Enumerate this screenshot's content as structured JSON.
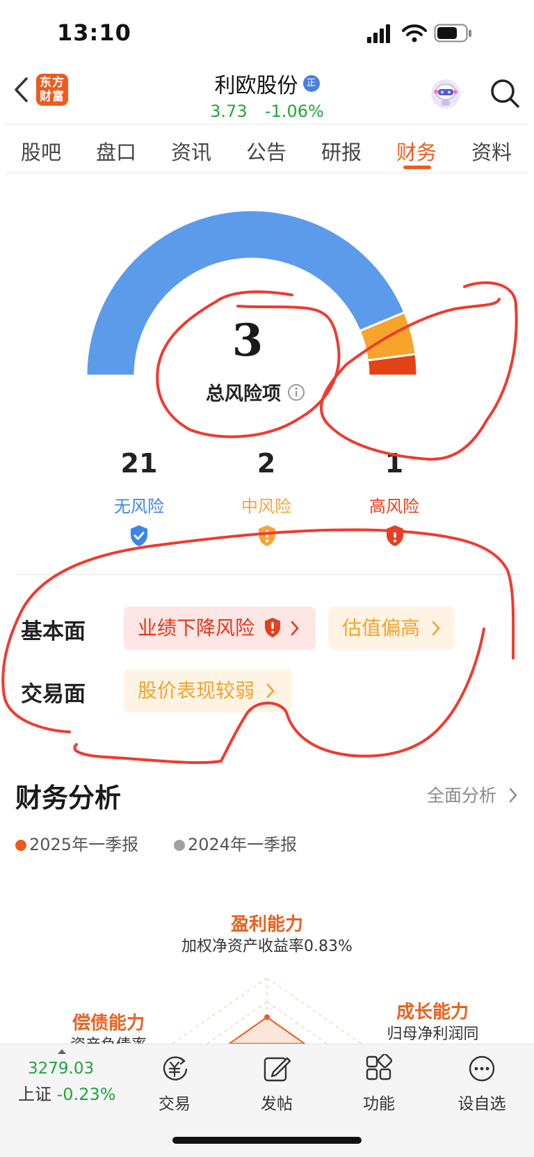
{
  "status_bar": {
    "time": "13:10"
  },
  "header": {
    "logo_text": "东方财富",
    "stock_name": "利欧股份",
    "name_badge": "正",
    "price": "3.73",
    "change": "-1.06%"
  },
  "tabs": [
    {
      "label": "股吧"
    },
    {
      "label": "盘口"
    },
    {
      "label": "资讯"
    },
    {
      "label": "公告"
    },
    {
      "label": "研报"
    },
    {
      "label": "财务",
      "active": true
    },
    {
      "label": "资料"
    }
  ],
  "risk_gauge": {
    "total_count": "3",
    "total_label": "总风险项",
    "segments": {
      "no_risk": 21,
      "medium_risk": 2,
      "high_risk": 1
    },
    "colors": {
      "no_risk": "#5b9bea",
      "medium_risk": "#f6a42b",
      "high_risk": "#e44318"
    },
    "items": [
      {
        "count": "21",
        "label": "无风险",
        "color": "#3f83e6"
      },
      {
        "count": "2",
        "label": "中风险",
        "color": "#f5a43b"
      },
      {
        "count": "1",
        "label": "高风险",
        "color": "#e2401f"
      }
    ]
  },
  "risk_rows": {
    "fundamental_label": "基本面",
    "fundamental_chips": [
      {
        "label": "业绩下降风险",
        "level": "high"
      },
      {
        "label": "估值偏高",
        "level": "medium"
      }
    ],
    "trading_label": "交易面",
    "trading_chips": [
      {
        "label": "股价表现较弱",
        "level": "medium"
      }
    ]
  },
  "finance": {
    "title": "财务分析",
    "more_link": "全面分析",
    "legend": [
      {
        "label": "2025年一季报",
        "color": "#ee5a1d"
      },
      {
        "label": "2024年一季报",
        "color": "#a0a0a0"
      }
    ],
    "radar": {
      "top_title": "盈利能力",
      "top_sub": "加权净资产收益率0.83%",
      "left_title": "偿债能力",
      "left_sub": "资产负债率",
      "right_title": "成长能力",
      "right_sub": "归母净利润同"
    }
  },
  "bottom_bar": {
    "index_value": "3279.03",
    "index_name": "上证",
    "index_change": "-0.23%",
    "items": [
      {
        "label": "交易",
        "icon": "yuan-exchange-icon"
      },
      {
        "label": "发帖",
        "icon": "edit-icon"
      },
      {
        "label": "功能",
        "icon": "grid-icon"
      },
      {
        "label": "设自选",
        "icon": "more-icon"
      }
    ]
  },
  "annotation_color": "#f03a2f"
}
